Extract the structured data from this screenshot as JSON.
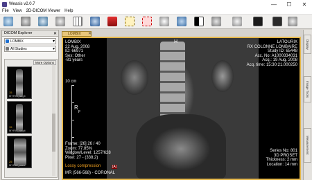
{
  "window": {
    "title": "Weasis v2.0.7",
    "min": "—",
    "max": "☐",
    "close": "✕"
  },
  "menu": [
    "File",
    "View",
    "2D-DICOM Viewer",
    "Help"
  ],
  "explorer": {
    "title": "DICOM Explorer",
    "patient": "LOMBIX",
    "studies": "All Studies",
    "more_options": "More Options",
    "thumbs": [
      {
        "num": "15",
        "label": "MYRIC_sagit"
      },
      {
        "num": "15",
        "label": "MYRIC_sagit"
      },
      {
        "num": "25",
        "label": "MYRIC_coro"
      }
    ]
  },
  "viewer": {
    "tab_label": "LOMBIX",
    "top_left": [
      "LOMBIX",
      "22 Aug. 2008",
      "ID: 66971",
      "Sex: Other",
      "-81 years"
    ],
    "top_right": [
      "LATOURIX",
      "RX COLONNE LOMBAIRE",
      "Study ID: 65448",
      "Acc. No: A1000334031",
      "Acq.: 19 Aug. 2008",
      "Acq. time: 15:30:21.000250"
    ],
    "ruler_label": "10 cm",
    "orient_top": "H",
    "orient_left": "R",
    "orient_sub": "F",
    "bottom_left": [
      "Frame: [26] 26 / 40",
      "Zoom: 77.85%",
      "Window/Level: 1257/628",
      "Pixel: 27 - (338,2)"
    ],
    "lossy": "Lossy compression",
    "lossy_tag": "[A]",
    "bottom_desc": "MR (566-568) - CORONAL",
    "bottom_right": [
      "Series No: 801",
      "3D PROSET",
      "Thickness: 2 mm",
      "Location: 14 mm"
    ]
  },
  "rightbar": [
    "Display",
    "Image Tools",
    "Measurement"
  ]
}
